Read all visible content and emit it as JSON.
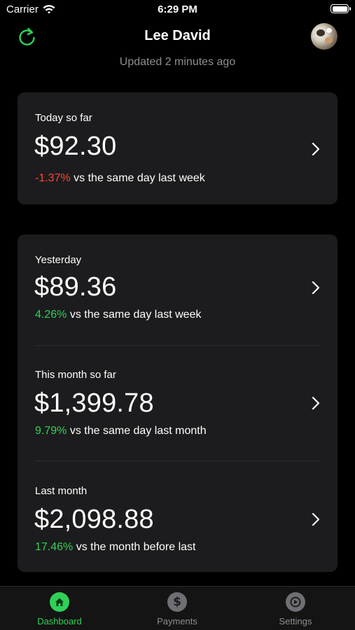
{
  "status_bar": {
    "carrier": "Carrier",
    "time": "6:29 PM"
  },
  "header": {
    "title": "Lee David",
    "subtitle": "Updated 2 minutes ago",
    "refresh_icon": "refresh-icon",
    "avatar_icon": "avatar"
  },
  "colors": {
    "background": "#000000",
    "card": "#1c1c1e",
    "accent_green": "#30d158",
    "negative_red": "#ff453a",
    "muted": "#8e8e93"
  },
  "stats": [
    {
      "label": "Today so far",
      "value": "$92.30",
      "pct": "-1.37%",
      "trend": "negative",
      "comparison": "vs the same day last week"
    },
    {
      "label": "Yesterday",
      "value": "$89.36",
      "pct": "4.26%",
      "trend": "positive",
      "comparison": "vs the same day last week"
    },
    {
      "label": "This month so far",
      "value": "$1,399.78",
      "pct": "9.79%",
      "trend": "positive",
      "comparison": "vs the same day last month"
    },
    {
      "label": "Last month",
      "value": "$2,098.88",
      "pct": "17.46%",
      "trend": "positive",
      "comparison": "vs the month before last"
    }
  ],
  "tabs": [
    {
      "label": "Dashboard",
      "icon": "home-icon",
      "active": true
    },
    {
      "label": "Payments",
      "icon": "dollar-icon",
      "active": false
    },
    {
      "label": "Settings",
      "icon": "settings-icon",
      "active": false
    }
  ]
}
